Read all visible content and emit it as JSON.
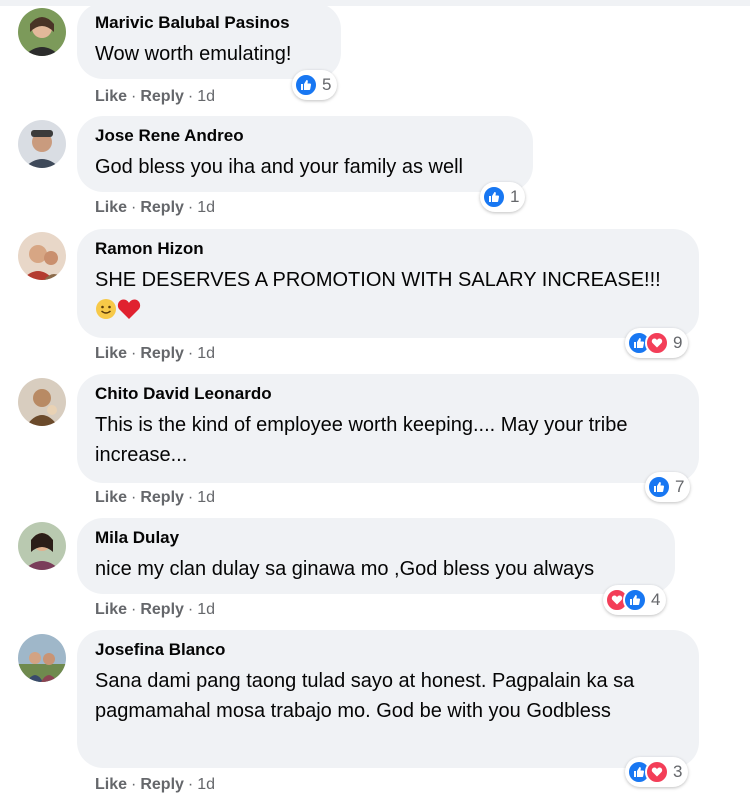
{
  "actions": {
    "like_label": "Like",
    "reply_label": "Reply",
    "separator": "·"
  },
  "colors": {
    "bubble": "#f0f2f5",
    "like_blue": "#1877f2",
    "love_red": "#f33e58",
    "meta_gray": "#65676b"
  },
  "comments": [
    {
      "author": "Marivic Balubal Pasinos",
      "text": "Wow worth emulating!",
      "time": "1d",
      "reactions": [
        "like-icon"
      ],
      "reaction_count": "5"
    },
    {
      "author": "Jose Rene Andreo",
      "text": "God bless you iha and your family as well",
      "time": "1d",
      "reactions": [
        "like-icon"
      ],
      "reaction_count": "1"
    },
    {
      "author": "Ramon Hizon",
      "text": "SHE DESERVES A PROMOTION WITH SALARY INCREASE!!!",
      "emojis": [
        "smile-emoji",
        "red-heart-emoji"
      ],
      "time": "1d",
      "reactions": [
        "like-icon",
        "love-icon"
      ],
      "reaction_count": "9"
    },
    {
      "author": "Chito David Leonardo",
      "text": "This is the kind of employee worth keeping.... May your tribe increase...",
      "time": "1d",
      "reactions": [
        "like-icon"
      ],
      "reaction_count": "7"
    },
    {
      "author": "Mila Dulay",
      "text": "nice my clan dulay sa ginawa mo ,God bless you always",
      "time": "1d",
      "reactions": [
        "love-icon",
        "like-icon"
      ],
      "reaction_count": "4"
    },
    {
      "author": "Josefina Blanco",
      "text": "Sana dami pang taong tulad sayo at honest. Pagpalain ka sa pagmamahal mosa trabajo mo. God be with you Godbless",
      "time": "1d",
      "reactions": [
        "like-icon",
        "love-icon"
      ],
      "reaction_count": "3"
    }
  ]
}
